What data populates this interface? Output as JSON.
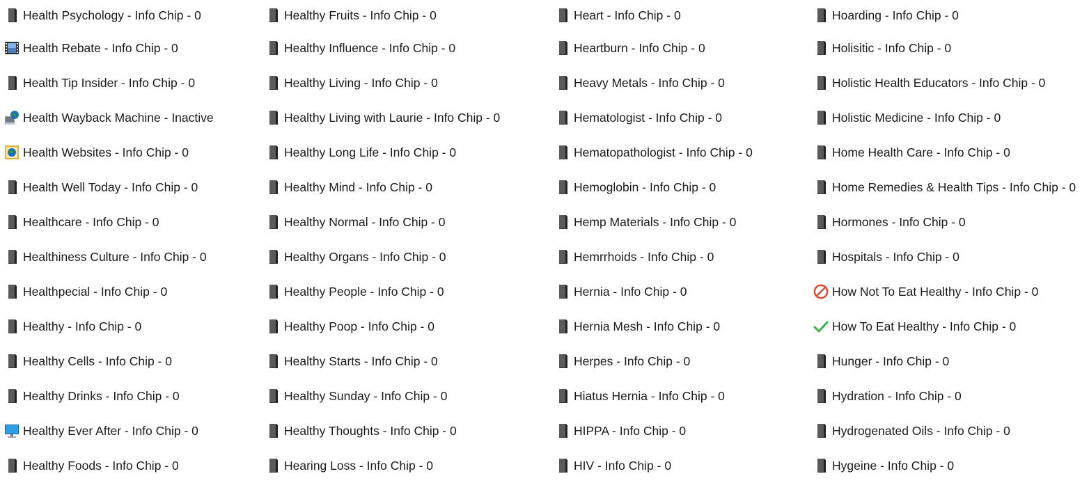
{
  "columns": [
    {
      "items": [
        {
          "label": "Health Psychology - Info Chip - 0",
          "icon": "file-icon"
        },
        {
          "label": "Health Rebate - Info Chip - 0",
          "icon": "film-icon"
        },
        {
          "label": "Health Tip Insider - Info Chip - 0",
          "icon": "file-icon"
        },
        {
          "label": "Health Wayback Machine - Inactive",
          "icon": "globe-computer-icon"
        },
        {
          "label": "Health Websites - Info Chip - 0",
          "icon": "globe-frame-icon"
        },
        {
          "label": "Health Well Today - Info Chip - 0",
          "icon": "file-icon"
        },
        {
          "label": "Healthcare - Info Chip - 0",
          "icon": "file-icon"
        },
        {
          "label": "Healthiness Culture - Info Chip - 0",
          "icon": "file-icon"
        },
        {
          "label": "Healthpecial - Info Chip - 0",
          "icon": "file-icon"
        },
        {
          "label": "Healthy - Info Chip - 0",
          "icon": "file-icon"
        },
        {
          "label": "Healthy Cells - Info Chip - 0",
          "icon": "file-icon"
        },
        {
          "label": "Healthy Drinks - Info Chip - 0",
          "icon": "file-icon"
        },
        {
          "label": "Healthy Ever After - Info Chip - 0",
          "icon": "monitor-icon"
        },
        {
          "label": "Healthy Foods - Info Chip - 0",
          "icon": "file-icon"
        }
      ]
    },
    {
      "items": [
        {
          "label": "Healthy Fruits - Info Chip - 0",
          "icon": "file-icon"
        },
        {
          "label": "Healthy Influence - Info Chip - 0",
          "icon": "file-icon"
        },
        {
          "label": "Healthy Living - Info Chip - 0",
          "icon": "file-icon"
        },
        {
          "label": "Healthy Living with Laurie - Info Chip - 0",
          "icon": "file-icon"
        },
        {
          "label": "Healthy Long Life - Info Chip - 0",
          "icon": "file-icon"
        },
        {
          "label": "Healthy Mind - Info Chip - 0",
          "icon": "file-icon"
        },
        {
          "label": "Healthy Normal - Info Chip - 0",
          "icon": "file-icon"
        },
        {
          "label": "Healthy Organs - Info Chip - 0",
          "icon": "file-icon"
        },
        {
          "label": "Healthy People - Info Chip - 0",
          "icon": "file-icon"
        },
        {
          "label": "Healthy Poop - Info Chip - 0",
          "icon": "file-icon"
        },
        {
          "label": "Healthy Starts - Info Chip - 0",
          "icon": "file-icon"
        },
        {
          "label": "Healthy Sunday - Info Chip - 0",
          "icon": "file-icon"
        },
        {
          "label": "Healthy Thoughts - Info Chip - 0",
          "icon": "file-icon"
        },
        {
          "label": "Hearing Loss - Info Chip - 0",
          "icon": "file-icon"
        }
      ]
    },
    {
      "items": [
        {
          "label": "Heart - Info Chip - 0",
          "icon": "file-icon"
        },
        {
          "label": "Heartburn - Info Chip - 0",
          "icon": "file-icon"
        },
        {
          "label": "Heavy Metals - Info Chip - 0",
          "icon": "file-icon"
        },
        {
          "label": "Hematologist - Info Chip - 0",
          "icon": "file-icon"
        },
        {
          "label": "Hematopathologist - Info Chip - 0",
          "icon": "file-icon"
        },
        {
          "label": "Hemoglobin - Info Chip - 0",
          "icon": "file-icon"
        },
        {
          "label": "Hemp Materials - Info Chip - 0",
          "icon": "file-icon"
        },
        {
          "label": "Hemrrhoids - Info Chip - 0",
          "icon": "file-icon"
        },
        {
          "label": "Hernia - Info Chip - 0",
          "icon": "file-icon"
        },
        {
          "label": "Hernia Mesh - Info Chip - 0",
          "icon": "file-icon"
        },
        {
          "label": "Herpes - Info Chip - 0",
          "icon": "file-icon"
        },
        {
          "label": "Hiatus Hernia - Info Chip - 0",
          "icon": "file-icon"
        },
        {
          "label": "HIPPA - Info Chip - 0",
          "icon": "file-icon"
        },
        {
          "label": "HIV - Info Chip - 0",
          "icon": "file-icon"
        }
      ]
    },
    {
      "items": [
        {
          "label": "Hoarding - Info Chip - 0",
          "icon": "file-icon"
        },
        {
          "label": "Holisitic - Info Chip - 0",
          "icon": "file-icon"
        },
        {
          "label": "Holistic Health Educators - Info Chip - 0",
          "icon": "file-icon"
        },
        {
          "label": "Holistic Medicine - Info Chip - 0",
          "icon": "file-icon"
        },
        {
          "label": "Home Health Care - Info Chip - 0",
          "icon": "file-icon"
        },
        {
          "label": "Home Remedies & Health Tips - Info Chip - 0",
          "icon": "file-icon"
        },
        {
          "label": "Hormones - Info Chip - 0",
          "icon": "file-icon"
        },
        {
          "label": "Hospitals - Info Chip - 0",
          "icon": "file-icon"
        },
        {
          "label": "How Not To Eat Healthy - Info Chip - 0",
          "icon": "prohibited-icon"
        },
        {
          "label": "How To Eat Healthy - Info Chip - 0",
          "icon": "checkmark-icon"
        },
        {
          "label": "Hunger - Info Chip - 0",
          "icon": "file-icon"
        },
        {
          "label": "Hydration - Info Chip - 0",
          "icon": "file-icon"
        },
        {
          "label": "Hydrogenated Oils - Info Chip - 0",
          "icon": "file-icon"
        },
        {
          "label": "Hygeine - Info Chip - 0",
          "icon": "file-icon"
        }
      ]
    }
  ],
  "colors": {
    "text": "#1b1b1b",
    "file_icon": "#4a4a4a",
    "prohibited": "#e0442a",
    "checkmark": "#3cb043",
    "monitor": "#1e90d6"
  }
}
